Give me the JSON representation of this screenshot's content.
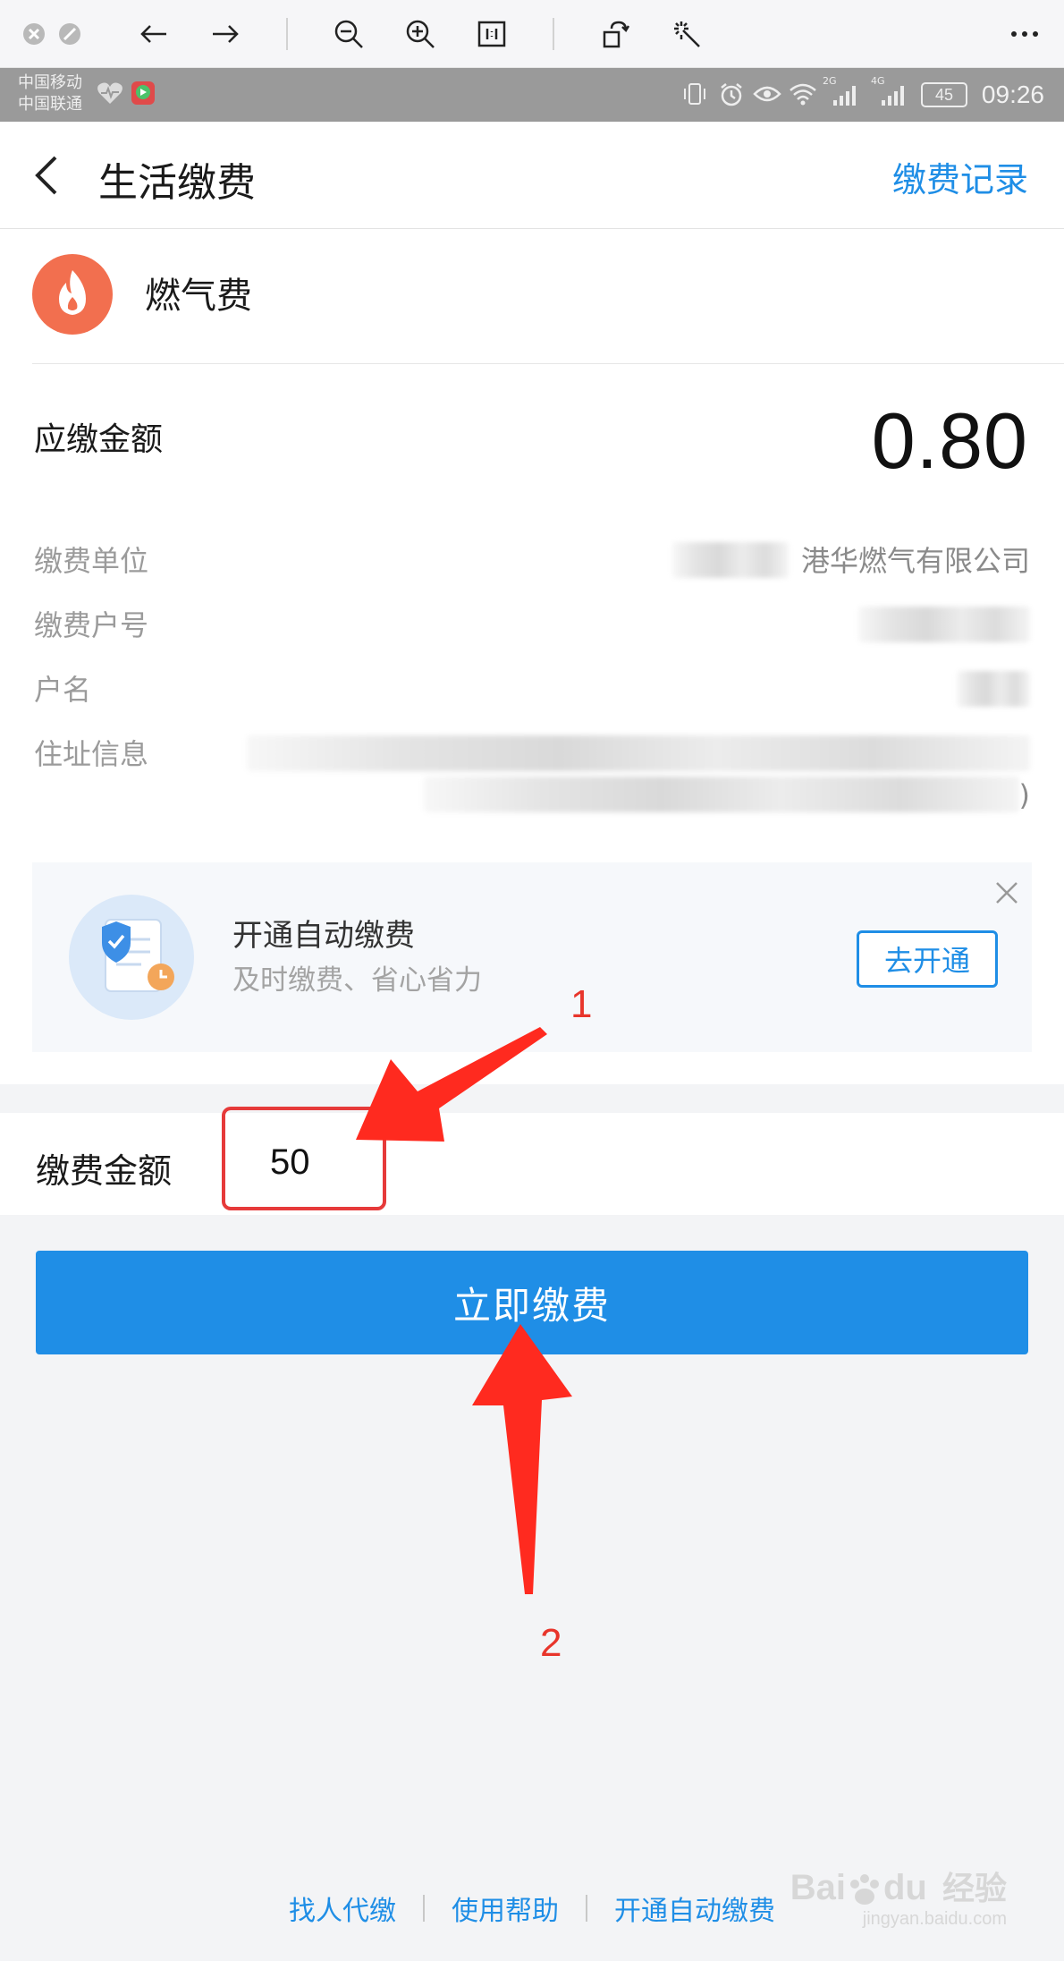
{
  "status_bar": {
    "carrier_1": "中国移动",
    "carrier_2": "中国联通",
    "net_2g": "2G",
    "net_4g": "4G",
    "battery": "45",
    "time": "09:26"
  },
  "header": {
    "title": "生活缴费",
    "record_link": "缴费记录"
  },
  "service": {
    "name": "燃气费",
    "icon": "flame-icon",
    "icon_color": "#f26f4f"
  },
  "bill": {
    "due_label": "应缴金额",
    "due_amount": "0.80",
    "rows": [
      {
        "label": "缴费单位",
        "value": "港华燃气有限公司"
      },
      {
        "label": "缴费户号",
        "value": ""
      },
      {
        "label": "户名",
        "value": ""
      },
      {
        "label": "住址信息",
        "value": ")"
      }
    ]
  },
  "promo": {
    "title": "开通自动缴费",
    "subtitle": "及时缴费、省心省力",
    "button": "去开通"
  },
  "payment": {
    "amount_label": "缴费金额",
    "amount_value": "50",
    "submit": "立即缴费"
  },
  "annotations": {
    "step1": "1",
    "step2": "2",
    "color": "#ff2a1f"
  },
  "footer": {
    "links": [
      "找人代缴",
      "使用帮助",
      "开通自动缴费"
    ]
  },
  "watermark": {
    "brand_left": "Bai",
    "brand_right": "du",
    "product": "经验",
    "url": "jingyan.baidu.com"
  },
  "colors": {
    "accent": "#1f8ee6",
    "annotation": "#e63a3a"
  }
}
